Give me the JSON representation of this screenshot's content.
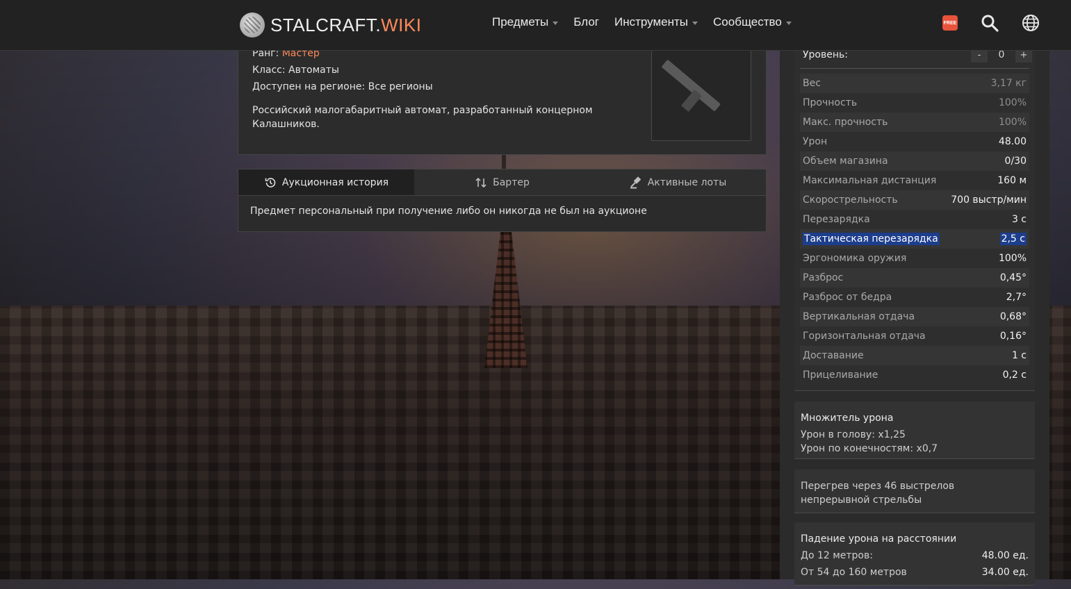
{
  "header": {
    "logo_main": "STALCRAFT.",
    "logo_accent": "WIKI",
    "nav": [
      {
        "label": "Предметы",
        "dropdown": true
      },
      {
        "label": "Блог",
        "dropdown": false
      },
      {
        "label": "Инструменты",
        "dropdown": true
      },
      {
        "label": "Сообщество",
        "dropdown": true
      }
    ],
    "free_badge": "FREE",
    "icons": [
      "free-icon",
      "search-icon",
      "globe-icon"
    ]
  },
  "item": {
    "rank_label": "Ранг:",
    "rank_value": "Мастер",
    "class_line": "Класс: Автоматы",
    "region_line": "Доступен на регионе: Все регионы",
    "description": "Российский малогабаритный автомат, разработанный концерном Калашников."
  },
  "tabs": {
    "items": [
      {
        "label": "Аукционная история",
        "icon": "history-icon",
        "active": true
      },
      {
        "label": "Бартер",
        "icon": "swap-icon",
        "active": false
      },
      {
        "label": "Активные лоты",
        "icon": "gavel-icon",
        "active": false
      }
    ],
    "content": "Предмет персональный при получение либо он никогда не был на аукционе"
  },
  "stats": {
    "level_label": "Уровень:",
    "level_minus": "-",
    "level_value": "0",
    "level_plus": "+",
    "rows": [
      {
        "name": "Вес",
        "value": "3,17 кг"
      },
      {
        "name": "Прочность",
        "value": "100%"
      },
      {
        "name": "Макс. прочность",
        "value": "100%"
      },
      {
        "name": "Урон",
        "value": "48.00"
      },
      {
        "name": "Объем магазина",
        "value": "0/30"
      },
      {
        "name": "Максимальная дистанция",
        "value": "160 м"
      },
      {
        "name": "Скорострельность",
        "value": "700 выстр/мин"
      },
      {
        "name": "Перезарядка",
        "value": "3 с"
      },
      {
        "name": "Тактическая перезарядка",
        "value": "2,5 с"
      },
      {
        "name": "Эргономика оружия",
        "value": "100%"
      },
      {
        "name": "Разброс",
        "value": "0,45°"
      },
      {
        "name": "Разброс от бедра",
        "value": "2,7°"
      },
      {
        "name": "Вертикальная отдача",
        "value": "0,68°"
      },
      {
        "name": "Горизонтальная отдача",
        "value": "0,16°"
      },
      {
        "name": "Доставание",
        "value": "1 с"
      },
      {
        "name": "Прицеливание",
        "value": "0,2 с"
      }
    ]
  },
  "damage_multiplier": {
    "title": "Множитель урона",
    "head": "Урон в голову: x1,25",
    "limbs": "Урон по конечностям: x0,7"
  },
  "overheat": {
    "text": "Перегрев через 46 выстрелов непрерывной стрельбы"
  },
  "falloff": {
    "title": "Падение урона на расстоянии",
    "rows": [
      {
        "label": "До 12 метров:",
        "value": "48.00 ед."
      },
      {
        "label": "От 54 до 160 метров",
        "value": "34.00 ед."
      }
    ]
  }
}
